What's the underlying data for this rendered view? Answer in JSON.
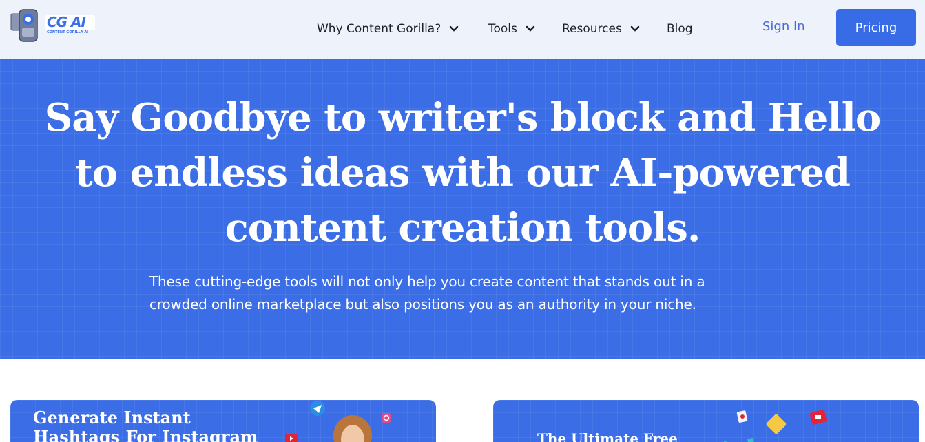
{
  "header": {
    "logo_text": "CG AI",
    "logo_subtext": "CONTENT GORILLA AI",
    "nav": [
      {
        "label": "Why Content Gorilla?",
        "has_dropdown": true
      },
      {
        "label": "Tools",
        "has_dropdown": true
      },
      {
        "label": "Resources",
        "has_dropdown": true
      },
      {
        "label": "Blog",
        "has_dropdown": false
      }
    ],
    "sign_in_label": "Sign In",
    "pricing_label": "Pricing"
  },
  "hero": {
    "title_lines": [
      "Say Goodbye to writer's block and Hello",
      "to endless ideas with our AI-powered",
      "content creation tools."
    ],
    "subtitle_lines": [
      "These cutting-edge tools will not only help you create content that stands out in a",
      "crowded online marketplace but also positions you as an authority in your niche."
    ]
  },
  "cards": [
    {
      "title_lines": [
        "Generate Instant",
        "Hashtags For Instagram"
      ]
    },
    {
      "title_lines": [
        "The Ultimate Free"
      ]
    }
  ],
  "colors": {
    "brand_blue": "#386be6",
    "hero_bg": "#3b6ee6",
    "header_bg": "#eef2fb",
    "link_blue": "#4a68d9"
  }
}
